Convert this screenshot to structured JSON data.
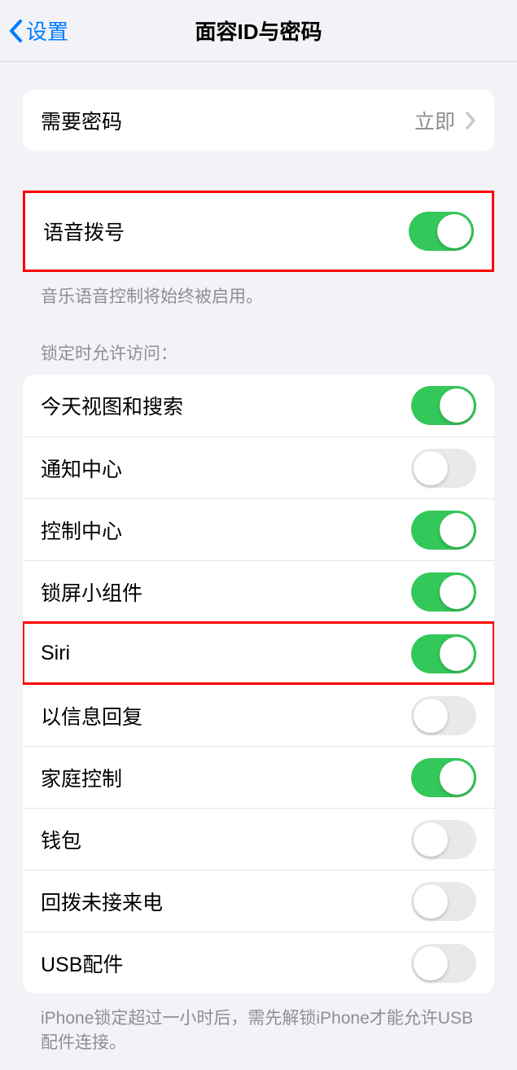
{
  "header": {
    "back_label": "设置",
    "title": "面容ID与密码"
  },
  "require_passcode": {
    "label": "需要密码",
    "value": "立即"
  },
  "voice_dial": {
    "label": "语音拨号",
    "on": true,
    "footnote": "音乐语音控制将始终被启用。"
  },
  "lock_screen_section": {
    "header": "锁定时允许访问：",
    "items": [
      {
        "label": "今天视图和搜索",
        "on": true
      },
      {
        "label": "通知中心",
        "on": false
      },
      {
        "label": "控制中心",
        "on": true
      },
      {
        "label": "锁屏小组件",
        "on": true
      },
      {
        "label": "Siri",
        "on": true
      },
      {
        "label": "以信息回复",
        "on": false
      },
      {
        "label": "家庭控制",
        "on": true
      },
      {
        "label": "钱包",
        "on": false
      },
      {
        "label": "回拨未接来电",
        "on": false
      },
      {
        "label": "USB配件",
        "on": false
      }
    ],
    "footnote": "iPhone锁定超过一小时后，需先解锁iPhone才能允许USB配件连接。"
  }
}
